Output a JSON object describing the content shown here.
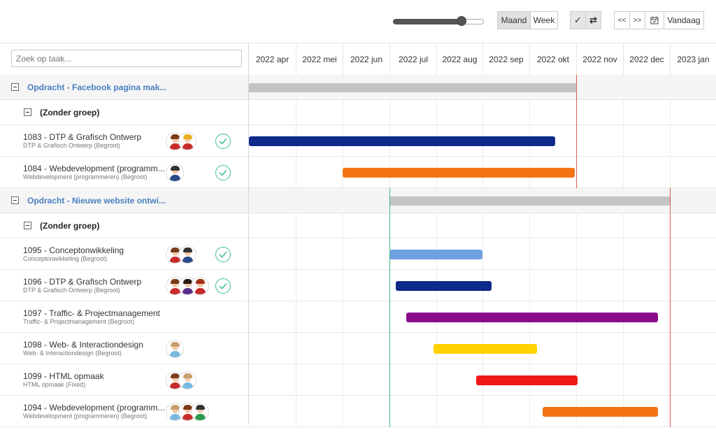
{
  "toolbar": {
    "zoom_fraction": 0.75,
    "view_buttons": [
      {
        "label": "Maand",
        "active": true
      },
      {
        "label": "Week",
        "active": false
      }
    ],
    "check_icon": "✓",
    "swap_icon": "⇄",
    "nav": {
      "prev": "<<",
      "next": ">>",
      "calendar_icon": "calendar-icon",
      "today": "Vandaag"
    }
  },
  "search": {
    "placeholder": "Zoek op taak..."
  },
  "months": [
    "2022 apr",
    "2022 mei",
    "2022 jun",
    "2022 jul",
    "2022 aug",
    "2022 sep",
    "2022 okt",
    "2022 nov",
    "2022 dec",
    "2023 jan"
  ],
  "rows": [
    {
      "type": "group",
      "title": "Opdracht - Facebook pagina mak...",
      "bar": {
        "start": "2022-04-01",
        "end": "2022-10-31",
        "color": "#c4c4c4"
      }
    },
    {
      "type": "subgroup",
      "title": "(Zonder groep)"
    },
    {
      "type": "task",
      "title": "1083 - DTP & Grafisch Ontwerp",
      "subtitle": "DTP & Grafisch Ontwerp (Begroot)",
      "avatars": [
        "female-brown",
        "female-blond"
      ],
      "done": true,
      "bar": {
        "start": "2022-04-01",
        "end": "2022-10-17",
        "color": "#0d2a8a"
      }
    },
    {
      "type": "task",
      "title": "1084 - Webdevelopment (programm...",
      "subtitle": "Webdevelopment (programmeren) (Begroot)",
      "avatars": [
        "male-dark"
      ],
      "done": true,
      "bar": {
        "start": "2022-06-01",
        "end": "2022-10-30",
        "color": "#f57315"
      }
    },
    {
      "type": "group",
      "title": "Opdracht - Nieuwe website ontwi...",
      "bar": {
        "start": "2022-07-01",
        "end": "2022-12-31",
        "color": "#c4c4c4"
      }
    },
    {
      "type": "subgroup",
      "title": "(Zonder groep)"
    },
    {
      "type": "task",
      "title": "1095 - Conceptonwikkeling",
      "subtitle": "Conceptonwikkeling (Begroot)",
      "avatars": [
        "female-brown",
        "male-dark"
      ],
      "done": true,
      "bar": {
        "start": "2022-07-01",
        "end": "2022-08-31",
        "color": "#6fa0e0"
      }
    },
    {
      "type": "task",
      "title": "1096 - DTP & Grafisch Ontwerp",
      "subtitle": "DTP & Grafisch Ontwerp (Begroot)",
      "avatars": [
        "female-brown",
        "female-dark",
        "female-red"
      ],
      "done": true,
      "bar": {
        "start": "2022-07-05",
        "end": "2022-09-06",
        "color": "#0d2a8a"
      }
    },
    {
      "type": "task",
      "title": "1097 - Traffic- & Projectmanagement",
      "subtitle": "Traffic- & Projectmanagement (Begroot)",
      "avatars": [],
      "done": false,
      "bar": {
        "start": "2022-07-12",
        "end": "2022-12-23",
        "color": "#8a0a8a"
      }
    },
    {
      "type": "task",
      "title": "1098 - Web- & Interactiondesign",
      "subtitle": "Web- & Interactiondesign (Begroot)",
      "avatars": [
        "male-light"
      ],
      "done": false,
      "bar": {
        "start": "2022-07-30",
        "end": "2022-10-05",
        "color": "#ffd200"
      }
    },
    {
      "type": "task",
      "title": "1099 - HTML opmaak",
      "subtitle": "HTML opmaak (Fixed)",
      "avatars": [
        "female-brown",
        "male-light"
      ],
      "done": false,
      "bar": {
        "start": "2022-08-28",
        "end": "2022-11-01",
        "color": "#f01818"
      }
    },
    {
      "type": "task",
      "title": "1094 - Webdevelopment (programm...",
      "subtitle": "Webdevelopment (programmeren) (Begroot)",
      "avatars": [
        "male-light",
        "female-brown",
        "male-green"
      ],
      "done": false,
      "bar": {
        "start": "2022-10-10",
        "end": "2022-12-23",
        "color": "#f57315"
      }
    }
  ],
  "markers": [
    {
      "group": 0,
      "date": "2022-10-31",
      "color": "#e05a4a"
    },
    {
      "group": 1,
      "date": "2022-07-01",
      "color": "#3bbf8a"
    },
    {
      "group": 1,
      "date": "2022-12-31",
      "color": "#e05a4a"
    }
  ]
}
